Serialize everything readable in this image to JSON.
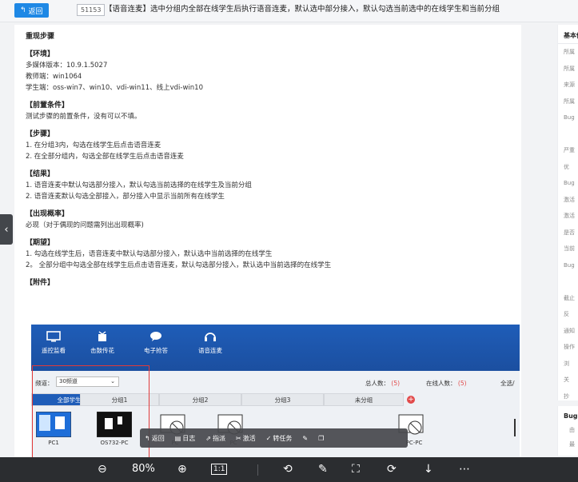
{
  "header": {
    "back_label": "返回",
    "bug_id": "51153",
    "title": "【语音连麦】选中分组内全部在线学生后执行语音连麦，默认选中部分接入，默认勾选当前选中的在线学生和当前分组"
  },
  "content": {
    "heading": "重现步骤",
    "env_title": "【环境】",
    "env_lines": [
      "多媒体版本：10.9.1.5027",
      "教师端：win1064",
      "学生端：oss-win7、win10、vdi-win11、线上vdi-win10"
    ],
    "pre_title": "【前置条件】",
    "pre_lines": [
      "测试步骤的前置条件，没有可以不填。"
    ],
    "steps_title": "【步骤】",
    "steps_lines": [
      "1. 在分组3内，勾选在线学生后点击语音连麦",
      "2. 在全部分组内，勾选全部在线学生后点击语音连麦"
    ],
    "result_title": "【结果】",
    "result_lines": [
      "1. 语音连麦中默认勾选部分接入，默认勾选当前选择的在线学生及当前分组",
      "2. 语音连麦默认勾选全部接入，部分接入中显示当前所有在线学生"
    ],
    "prob_title": "【出现概率】",
    "prob_lines": [
      "必现（对于偶现的问题需列出出现概率)"
    ],
    "expect_title": "【期望】",
    "expect_lines": [
      "1. 勾选在线学生后，语音连麦中默认勾选部分接入，默认选中当前选择的在线学生",
      "2。 全部分组中勾选全部在线学生后点击语音连麦，默认勾选部分接入，默认选中当前选择的在线学生"
    ],
    "attach_title": "【附件】"
  },
  "attachment": {
    "tools": [
      "遥控监看",
      "击鼓传花",
      "电子抢答",
      "语音连麦"
    ],
    "channel_label": "频道：",
    "channel_value": "30频道",
    "total_label": "总人数：",
    "total_value": "(5)",
    "online_label": "在线人数：",
    "online_value": "(5)",
    "select_all": "全选/",
    "tabs": [
      "全部学生",
      "分组1",
      "分组2",
      "分组3",
      "未分组"
    ],
    "students": [
      "PC1",
      "OS732-PC",
      "PC",
      "PC",
      "PC-PC"
    ],
    "colors": {
      "toolbar": "#1f5db8",
      "active_tab": "#1f5db8",
      "alert": "#e24a4a"
    }
  },
  "floatbar": {
    "items": [
      "返回",
      "日志",
      "指派",
      "激活",
      "转任务"
    ]
  },
  "right_panel": {
    "basic_title": "基本信",
    "fields": [
      "所属",
      "所属",
      "来源",
      "所属",
      "Bug",
      "",
      "严重",
      "优",
      "Bug",
      "激活",
      "激活",
      "是否",
      "当前",
      "Bug",
      "",
      "截止",
      "反",
      "通知",
      "操作",
      "浏",
      "关",
      "抄"
    ],
    "bug_title": "Bug",
    "bug_items": [
      "由",
      "最"
    ]
  },
  "viewer": {
    "zoom": "80%",
    "fit_label": "1:1"
  }
}
